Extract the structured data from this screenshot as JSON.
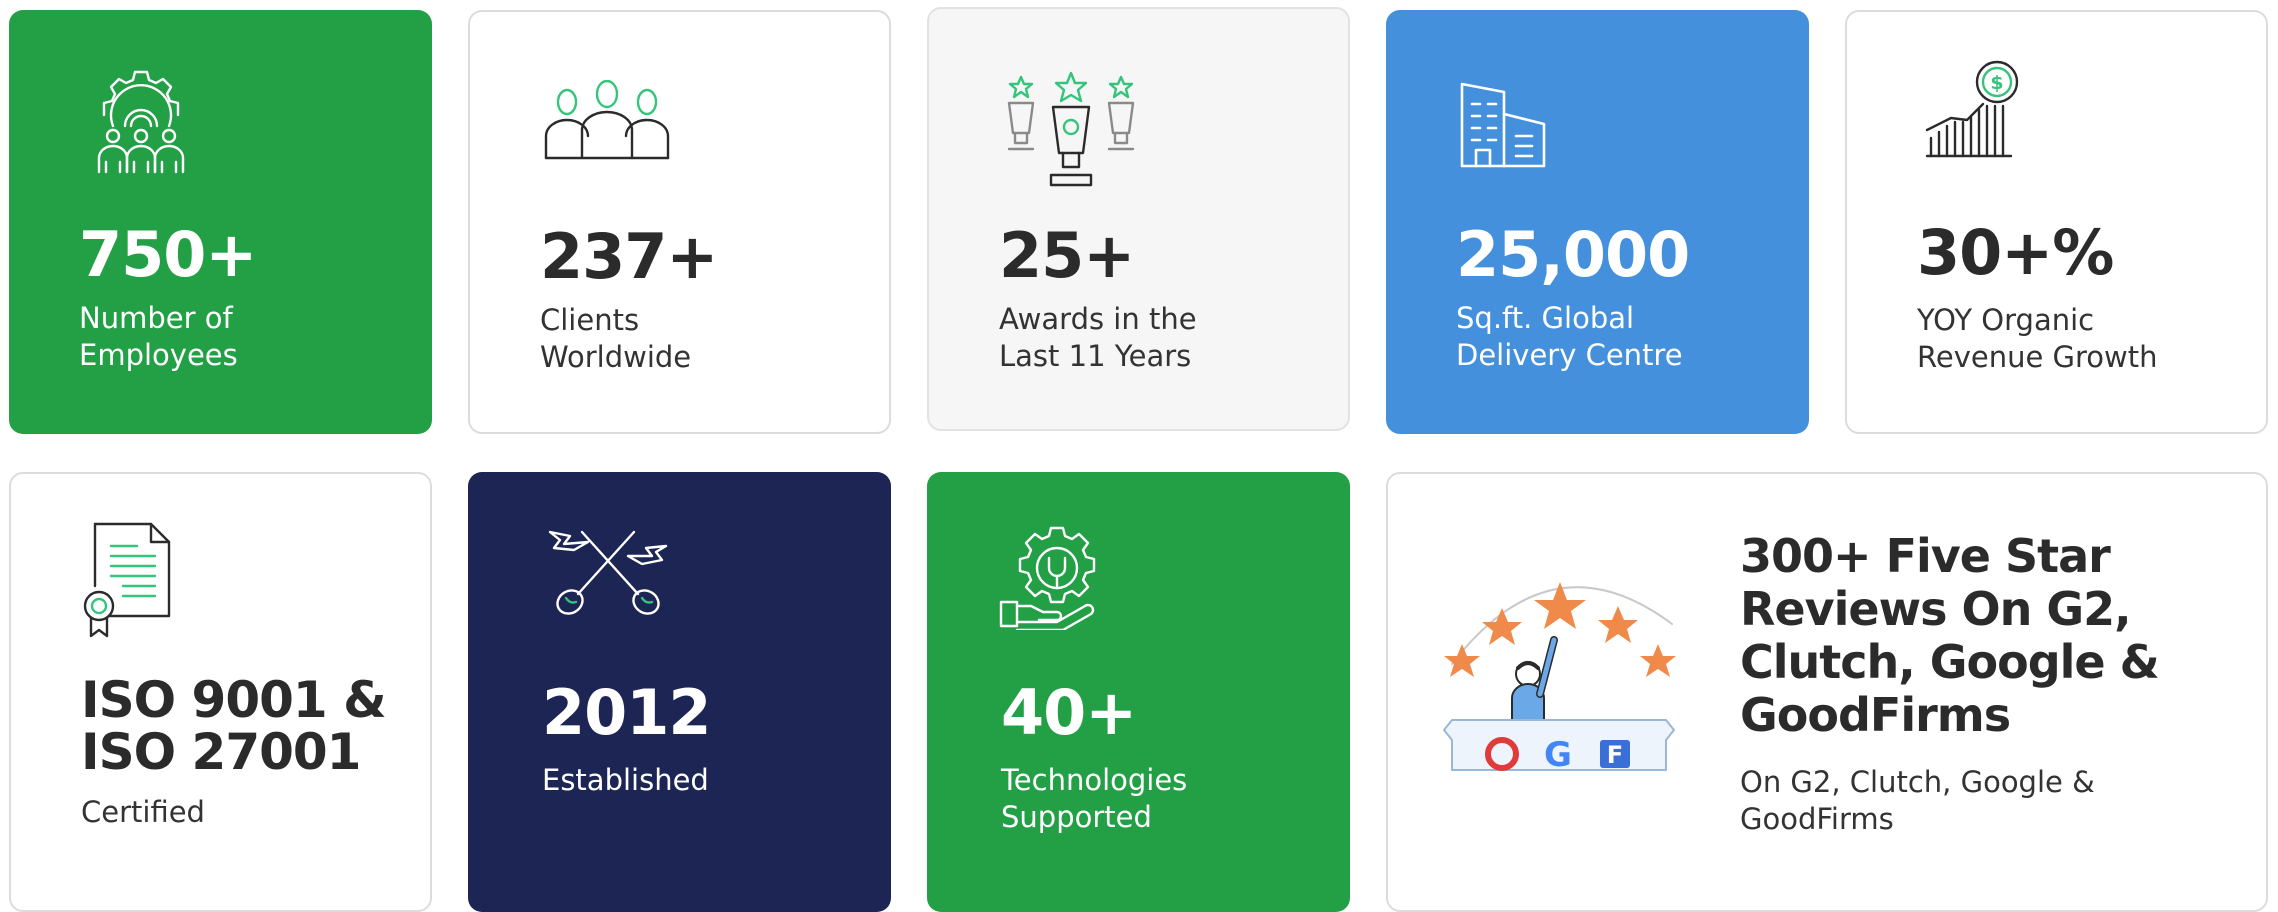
{
  "colors": {
    "green": "#23a046",
    "blue": "#4590dd",
    "navy": "#1c2554",
    "accent_green": "#34c47a",
    "dark_text": "#2b2b2b"
  },
  "stats": [
    {
      "value": "750+",
      "label": "Number of\nEmployees",
      "icon": "team-gear-icon"
    },
    {
      "value": "237+",
      "label": "Clients\nWorldwide",
      "icon": "clients-icon"
    },
    {
      "value": "25+",
      "label": "Awards in the\nLast 11 Years",
      "icon": "trophy-icon"
    },
    {
      "value": "25,000",
      "label": "Sq.ft. Global\nDelivery Centre",
      "icon": "building-icon"
    },
    {
      "value": "30+%",
      "label": "YOY Organic\nRevenue Growth",
      "icon": "growth-chart-icon"
    },
    {
      "value": "ISO 9001 &\nISO 27001",
      "label": "Certified",
      "icon": "certificate-icon"
    },
    {
      "value": "2012",
      "label": "Established",
      "icon": "ribbon-scissors-icon"
    },
    {
      "value": "40+",
      "label": "Technologies\nSupported",
      "icon": "gear-hand-icon"
    }
  ],
  "reviews": {
    "title": "300+ Five Star\nReviews On G2,\nClutch, Google &\nGoodFirms",
    "subtitle": "On G2, Clutch, Google &\nGoodFirms",
    "icon": "five-star-reviews-icon",
    "logos": [
      "C",
      "G",
      "F"
    ]
  }
}
